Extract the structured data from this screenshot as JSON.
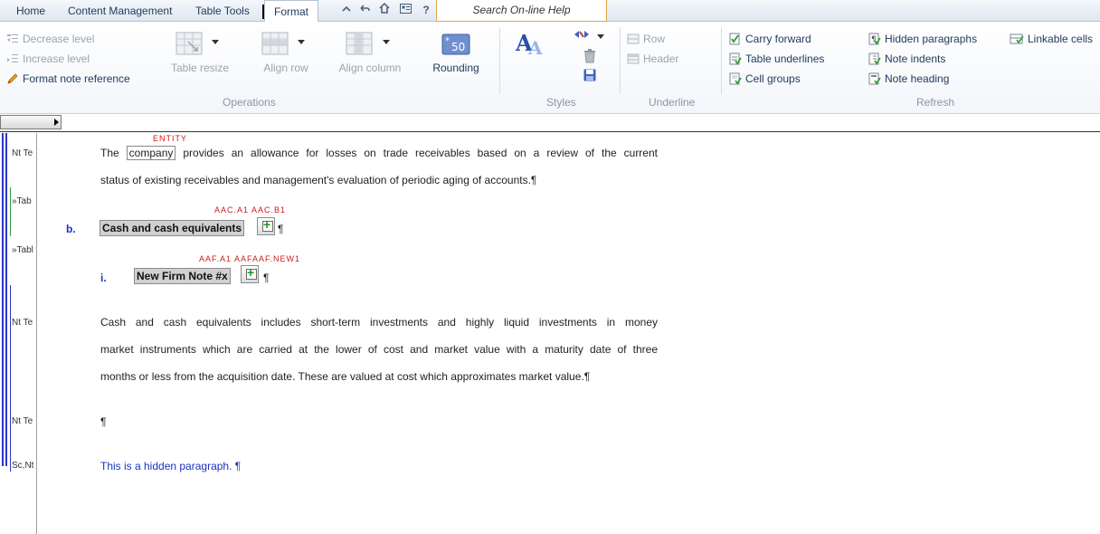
{
  "tabs": {
    "home": "Home",
    "content_management": "Content Management",
    "table_tools": "Table Tools",
    "format": "Format"
  },
  "search_help": {
    "placeholder": "Search On-line Help"
  },
  "ribbon": {
    "decrease_level": "Decrease level",
    "increase_level": "Increase level",
    "format_note_reference": "Format note reference",
    "table_resize": "Table resize",
    "align_row": "Align row",
    "align_column": "Align column",
    "rounding": "Rounding",
    "row": "Row",
    "header": "Header",
    "carry_forward": "Carry forward",
    "table_underlines": "Table underlines",
    "cell_groups": "Cell groups",
    "hidden_paragraphs": "Hidden paragraphs",
    "note_indents": "Note indents",
    "note_heading": "Note heading",
    "linkable_cells": "Linkable cells",
    "group_operations": "Operations",
    "group_styles": "Styles",
    "group_underline": "Underline",
    "group_refresh": "Refresh"
  },
  "gutter": {
    "row1": "Nt Te",
    "row2": "»Tab",
    "row3": "»Tabl",
    "row4": "Nt Te",
    "row5": "Nt Te",
    "row6": "Sc,Nt"
  },
  "document": {
    "entity_tag": "ENTITY",
    "p1_line1_pre": "The",
    "p1_entity": "company",
    "p1_line1_post": "provides an allowance for losses on trade receivables based on a review of the current",
    "p1_line2": "status of existing receivables and management's evaluation of periodic aging of accounts.¶",
    "h1_tags": "AAC.A1 AAC.B1",
    "h1_number": "b.",
    "h1_text": "Cash and cash equivalents",
    "h2_tags": "AAF.A1 AAFAAF.NEW1",
    "h2_number": "i.",
    "h2_text": "New Firm Note #x",
    "p2_line1": "Cash and cash equivalents includes short-term investments and highly liquid investments in money",
    "p2_line2": "market instruments which are carried at the lower of cost and market value with a maturity date of three",
    "p2_line3": "months or less from the acquisition date.  These are valued at cost which approximates market value.¶",
    "empty_para": "¶",
    "hidden_para": "This is a hidden paragraph. ¶",
    "pilcrow": "¶"
  }
}
